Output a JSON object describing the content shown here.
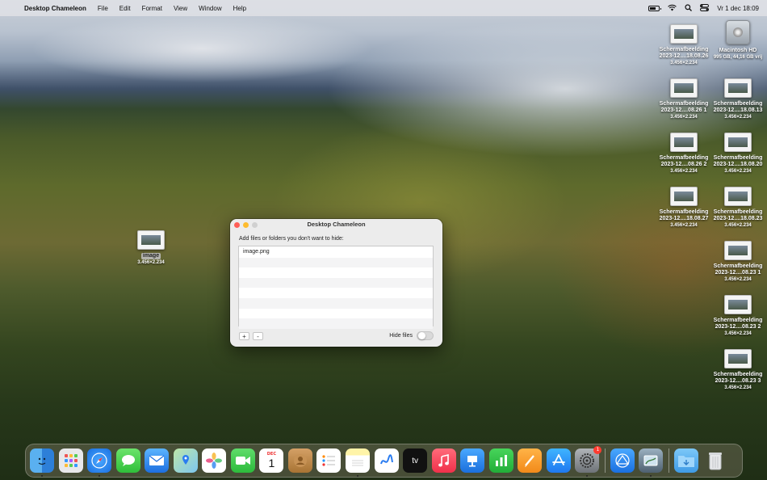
{
  "menubar": {
    "apple": "",
    "app_name": "Desktop Chameleon",
    "menus": [
      "File",
      "Edit",
      "Format",
      "View",
      "Window",
      "Help"
    ],
    "date_time": "Vr 1 dec  18:09"
  },
  "desktop_icons": [
    {
      "name": "Schermafbeelding",
      "line2": "2023-12....18.08.26",
      "meta": "3.456×2.234"
    },
    {
      "name": "Macintosh HD",
      "line2": "",
      "meta": "995 GB, 44,16 GB vrij"
    },
    {
      "name": "Schermafbeelding",
      "line2": "2023-12....08.26 1",
      "meta": "3.456×2.234"
    },
    {
      "name": "Schermafbeelding",
      "line2": "2023-12....18.08.13",
      "meta": "3.456×2.234"
    },
    {
      "name": "Schermafbeelding",
      "line2": "2023-12....08.26 2",
      "meta": "3.456×2.234"
    },
    {
      "name": "Schermafbeelding",
      "line2": "2023-12....18.08.20",
      "meta": "3.456×2.234"
    },
    {
      "name": "Schermafbeelding",
      "line2": "2023-12....18.08.27",
      "meta": "3.456×2.234"
    },
    {
      "name": "Schermafbeelding",
      "line2": "2023-12....18.08.23",
      "meta": "3.456×2.234"
    },
    {
      "name": "Schermafbeelding",
      "line2": "2023-12....08.23 1",
      "meta": "3.456×2.234"
    },
    {
      "name": "Schermafbeelding",
      "line2": "2023-12....08.23 2",
      "meta": "3.456×2.234"
    },
    {
      "name": "Schermafbeelding",
      "line2": "2023-12....08.23 3",
      "meta": "3.456×2.234"
    },
    {
      "name": "image",
      "line2": "",
      "meta": "3.456×2.234"
    }
  ],
  "window": {
    "title": "Desktop Chameleon",
    "instruction": "Add files or folders you don't want to hide:",
    "files": [
      "image.png"
    ],
    "add_label": "+",
    "remove_label": "-",
    "hide_files_label": "Hide files",
    "hide_files_on": false
  },
  "dock": {
    "calendar_month": "DEC",
    "calendar_day": "1",
    "settings_badge": "1",
    "appletv_label": "tv"
  }
}
